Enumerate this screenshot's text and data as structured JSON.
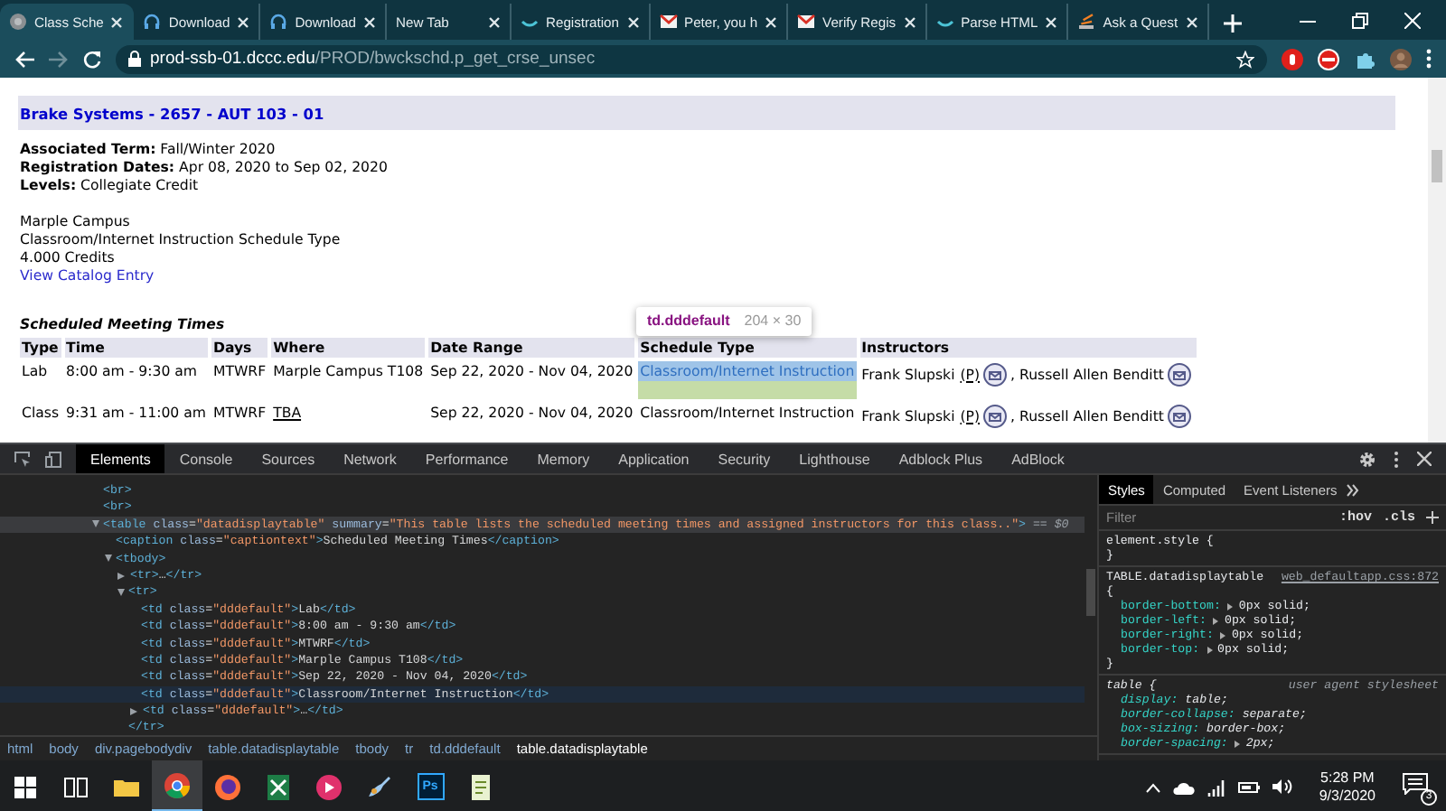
{
  "browser": {
    "tabs": [
      {
        "title": "Class Sche",
        "kind": "globe",
        "selected": true
      },
      {
        "title": "Download",
        "kind": "headset",
        "selected": false
      },
      {
        "title": "Download",
        "kind": "headset",
        "selected": false
      },
      {
        "title": "New Tab",
        "kind": "blank",
        "selected": false
      },
      {
        "title": "Registration",
        "kind": "bowl",
        "selected": false
      },
      {
        "title": "Peter, you h",
        "kind": "mail",
        "selected": false
      },
      {
        "title": "Verify Regis",
        "kind": "mail",
        "selected": false
      },
      {
        "title": "Parse HTML",
        "kind": "bowl",
        "selected": false
      },
      {
        "title": "Ask a Quest",
        "kind": "stack",
        "selected": false
      }
    ],
    "address": {
      "host": "prod-ssb-01.dccc.edu",
      "path": "/PROD/bwckschd.p_get_crse_unsec"
    }
  },
  "page": {
    "title": "Brake Systems - 2657 - AUT 103 - 01",
    "details": [
      "**Associated Term:** Fall/Winter 2020",
      "**Registration Dates:** Apr 08, 2020 to Sep 02, 2020",
      "**Levels:** Collegiate Credit"
    ],
    "notes": [
      "Marple Campus",
      "Classroom/Internet Instruction Schedule Type",
      "4.000 Credits"
    ],
    "catalog_link": "View Catalog Entry",
    "table": {
      "caption": "Scheduled Meeting Times",
      "columns": [
        "Type",
        "Time",
        "Days",
        "Where",
        "Date Range",
        "Schedule Type",
        "Instructors"
      ],
      "rows": [
        {
          "type": "Lab",
          "time": "8:00 am - 9:30 am",
          "days": "MTWRF",
          "where": "Marple Campus T108",
          "where_link": false,
          "date_range": "Sep 22, 2020 - Nov 04, 2020",
          "schedule_type": "Classroom/Internet Instruction",
          "highlighted": true,
          "instructors": [
            {
              "name": "Frank Slupski",
              "tag": "(P)"
            },
            {
              "name": ", Russell Allen Benditt"
            }
          ]
        },
        {
          "type": "Class",
          "time": "9:31 am - 11:00 am",
          "days": "MTWRF",
          "where": "TBA",
          "where_link": true,
          "date_range": "Sep 22, 2020 - Nov 04, 2020",
          "schedule_type": "Classroom/Internet Instruction",
          "highlighted": false,
          "instructors": [
            {
              "name": "Frank Slupski",
              "tag": "(P)"
            },
            {
              "name": ", Russell Allen Benditt"
            }
          ]
        }
      ]
    },
    "tooltip": {
      "selector": "td.dddefault",
      "size": "204 × 30"
    }
  },
  "devtools": {
    "tabs": [
      {
        "label": "Elements",
        "selected": true
      },
      {
        "label": "Console",
        "selected": false
      },
      {
        "label": "Sources",
        "selected": false
      },
      {
        "label": "Network",
        "selected": false
      },
      {
        "label": "Performance",
        "selected": false
      },
      {
        "label": "Memory",
        "selected": false
      },
      {
        "label": "Application",
        "selected": false
      },
      {
        "label": "Security",
        "selected": false
      },
      {
        "label": "Lighthouse",
        "selected": false
      },
      {
        "label": "Adblock Plus",
        "selected": false
      },
      {
        "label": "AdBlock",
        "selected": false
      }
    ],
    "tree": [
      {
        "tokens": [
          {
            "kind": "tag",
            "text": "<br>"
          }
        ],
        "selected": false,
        "hovered": false
      },
      {
        "tokens": [
          {
            "kind": "tag",
            "text": "<br>"
          }
        ],
        "selected": false,
        "hovered": false
      },
      {
        "tokens": [
          {
            "kind": "tag",
            "text": "<table"
          },
          {
            "kind": "attr",
            "text": " class"
          },
          {
            "kind": "text",
            "text": "="
          },
          {
            "kind": "value",
            "text": "\"datadisplaytable\""
          },
          {
            "kind": "attr",
            "text": " summary"
          },
          {
            "kind": "text",
            "text": "="
          },
          {
            "kind": "value",
            "text": "\"This table lists the scheduled meeting times and assigned instructors for this class..\""
          },
          {
            "kind": "tag",
            "text": ">"
          },
          {
            "kind": "note",
            "text": " == $0"
          }
        ],
        "expanded": true,
        "selected": true,
        "hovered": false,
        "children": [
          {
            "tokens": [
              {
                "kind": "tag",
                "text": "<caption"
              },
              {
                "kind": "attr",
                "text": " class"
              },
              {
                "kind": "text",
                "text": "="
              },
              {
                "kind": "value",
                "text": "\"captiontext\""
              },
              {
                "kind": "tag",
                "text": ">"
              },
              {
                "kind": "text",
                "text": "Scheduled Meeting Times"
              },
              {
                "kind": "tag",
                "text": "</caption>"
              }
            ],
            "selected": false,
            "hovered": false
          },
          {
            "tokens": [
              {
                "kind": "tag",
                "text": "<tbody>"
              }
            ],
            "expanded": true,
            "selected": false,
            "hovered": false,
            "children": [
              {
                "tokens": [
                  {
                    "kind": "tag",
                    "text": "<tr>"
                  },
                  {
                    "kind": "text",
                    "text": "…"
                  },
                  {
                    "kind": "tag",
                    "text": "</tr>"
                  }
                ],
                "expanded": false,
                "selected": false,
                "hovered": false
              },
              {
                "tokens": [
                  {
                    "kind": "tag",
                    "text": "<tr>"
                  }
                ],
                "expanded": true,
                "selected": false,
                "hovered": false,
                "closing": [
                  {
                    "kind": "tag",
                    "text": "</tr>"
                  }
                ],
                "children": [
                  {
                    "tokens": [
                      {
                        "kind": "tag",
                        "text": "<td"
                      },
                      {
                        "kind": "attr",
                        "text": " class"
                      },
                      {
                        "kind": "text",
                        "text": "="
                      },
                      {
                        "kind": "value",
                        "text": "\"dddefault\""
                      },
                      {
                        "kind": "tag",
                        "text": ">"
                      },
                      {
                        "kind": "text",
                        "text": "Lab"
                      },
                      {
                        "kind": "tag",
                        "text": "</td>"
                      }
                    ],
                    "selected": false,
                    "hovered": false
                  },
                  {
                    "tokens": [
                      {
                        "kind": "tag",
                        "text": "<td"
                      },
                      {
                        "kind": "attr",
                        "text": " class"
                      },
                      {
                        "kind": "text",
                        "text": "="
                      },
                      {
                        "kind": "value",
                        "text": "\"dddefault\""
                      },
                      {
                        "kind": "tag",
                        "text": ">"
                      },
                      {
                        "kind": "text",
                        "text": "8:00 am - 9:30 am"
                      },
                      {
                        "kind": "tag",
                        "text": "</td>"
                      }
                    ],
                    "selected": false,
                    "hovered": false
                  },
                  {
                    "tokens": [
                      {
                        "kind": "tag",
                        "text": "<td"
                      },
                      {
                        "kind": "attr",
                        "text": " class"
                      },
                      {
                        "kind": "text",
                        "text": "="
                      },
                      {
                        "kind": "value",
                        "text": "\"dddefault\""
                      },
                      {
                        "kind": "tag",
                        "text": ">"
                      },
                      {
                        "kind": "text",
                        "text": "MTWRF"
                      },
                      {
                        "kind": "tag",
                        "text": "</td>"
                      }
                    ],
                    "selected": false,
                    "hovered": false
                  },
                  {
                    "tokens": [
                      {
                        "kind": "tag",
                        "text": "<td"
                      },
                      {
                        "kind": "attr",
                        "text": " class"
                      },
                      {
                        "kind": "text",
                        "text": "="
                      },
                      {
                        "kind": "value",
                        "text": "\"dddefault\""
                      },
                      {
                        "kind": "tag",
                        "text": ">"
                      },
                      {
                        "kind": "text",
                        "text": "Marple Campus T108"
                      },
                      {
                        "kind": "tag",
                        "text": "</td>"
                      }
                    ],
                    "selected": false,
                    "hovered": false
                  },
                  {
                    "tokens": [
                      {
                        "kind": "tag",
                        "text": "<td"
                      },
                      {
                        "kind": "attr",
                        "text": " class"
                      },
                      {
                        "kind": "text",
                        "text": "="
                      },
                      {
                        "kind": "value",
                        "text": "\"dddefault\""
                      },
                      {
                        "kind": "tag",
                        "text": ">"
                      },
                      {
                        "kind": "text",
                        "text": "Sep 22, 2020 - Nov 04, 2020"
                      },
                      {
                        "kind": "tag",
                        "text": "</td>"
                      }
                    ],
                    "selected": false,
                    "hovered": false
                  },
                  {
                    "tokens": [
                      {
                        "kind": "tag",
                        "text": "<td"
                      },
                      {
                        "kind": "attr",
                        "text": " class"
                      },
                      {
                        "kind": "text",
                        "text": "="
                      },
                      {
                        "kind": "value",
                        "text": "\"dddefault\""
                      },
                      {
                        "kind": "tag",
                        "text": ">"
                      },
                      {
                        "kind": "text",
                        "text": "Classroom/Internet Instruction"
                      },
                      {
                        "kind": "tag",
                        "text": "</td>"
                      }
                    ],
                    "selected": false,
                    "hovered": true
                  },
                  {
                    "tokens": [
                      {
                        "kind": "tag",
                        "text": "<td"
                      },
                      {
                        "kind": "attr",
                        "text": " class"
                      },
                      {
                        "kind": "text",
                        "text": "="
                      },
                      {
                        "kind": "value",
                        "text": "\"dddefault\""
                      },
                      {
                        "kind": "tag",
                        "text": ">"
                      },
                      {
                        "kind": "text",
                        "text": "…"
                      },
                      {
                        "kind": "tag",
                        "text": "</td>"
                      }
                    ],
                    "expanded": false,
                    "selected": false,
                    "hovered": false
                  }
                ]
              }
            ]
          }
        ]
      }
    ],
    "breadcrumbs": [
      {
        "label": "html",
        "selected": false
      },
      {
        "label": "body",
        "selected": false
      },
      {
        "label": "div.pagebodydiv",
        "selected": false
      },
      {
        "label": "table.datadisplaytable",
        "selected": false
      },
      {
        "label": "tbody",
        "selected": false
      },
      {
        "label": "tr",
        "selected": false
      },
      {
        "label": "td.dddefault",
        "selected": false
      },
      {
        "label": "table.datadisplaytable",
        "selected": true
      }
    ],
    "styles": {
      "tabs": [
        {
          "label": "Styles",
          "selected": true
        },
        {
          "label": "Computed",
          "selected": false
        },
        {
          "label": "Event Listeners",
          "selected": false
        }
      ],
      "filter_placeholder": "Filter",
      "buttons": [
        ":hov",
        ".cls"
      ],
      "rules": [
        {
          "kind": "inline",
          "selector": "element.style {",
          "close": "}"
        },
        {
          "kind": "author",
          "selector": "TABLE.datadisplaytable {",
          "source": "web_defaultapp.css:872",
          "close": "}",
          "properties": [
            {
              "name": "border-bottom:",
              "value": "0px solid;",
              "expandable": true
            },
            {
              "name": "border-left:",
              "value": "0px solid;",
              "expandable": true
            },
            {
              "name": "border-right:",
              "value": "0px solid;",
              "expandable": true
            },
            {
              "name": "border-top:",
              "value": "0px solid;",
              "expandable": true
            }
          ]
        },
        {
          "kind": "user-agent",
          "selector": "table {",
          "source": "user agent stylesheet",
          "properties": [
            {
              "name": "display:",
              "value": "table;",
              "expandable": false
            },
            {
              "name": "border-collapse:",
              "value": "separate;",
              "expandable": false
            },
            {
              "name": "box-sizing:",
              "value": "border-box;",
              "expandable": false
            },
            {
              "name": "border-spacing:",
              "value": "2px;",
              "expandable": true
            }
          ]
        }
      ]
    }
  },
  "taskbar": {
    "apps": [
      {
        "kind": "windows",
        "selected": false
      },
      {
        "kind": "taskview",
        "selected": false
      },
      {
        "kind": "folder",
        "selected": false
      },
      {
        "kind": "chrome",
        "selected": true
      },
      {
        "kind": "firefox",
        "selected": false
      },
      {
        "kind": "sheet",
        "selected": false
      },
      {
        "kind": "media",
        "selected": false
      },
      {
        "kind": "paint",
        "selected": false
      },
      {
        "kind": "ps",
        "label": "Ps",
        "selected": false
      },
      {
        "kind": "editor",
        "selected": false
      }
    ],
    "time": "5:28 PM",
    "date": "9/3/2020",
    "notifications": "3"
  }
}
